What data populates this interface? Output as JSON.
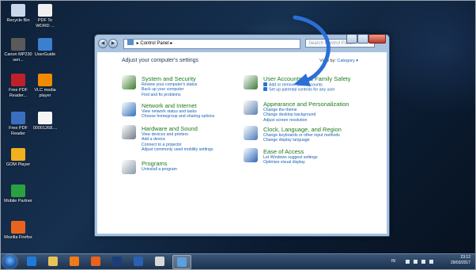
{
  "desktop": {
    "icons": [
      {
        "label": "Recycle Bin",
        "icon": "recycle-bin-icon",
        "color": "#c8d8ea"
      },
      {
        "label": "PDF To WORD ...",
        "icon": "pdf-document-icon",
        "color": "#f0f0f0"
      },
      {
        "label": "Canon MP230 seri...",
        "icon": "printer-icon",
        "color": "#5a5a5a"
      },
      {
        "label": "UserGuide",
        "icon": "guide-icon",
        "color": "#3a7fd0"
      },
      {
        "label": "Free PDF Reader...",
        "icon": "pdf-reader-icon",
        "color": "#c0202a"
      },
      {
        "label": "VLC media player",
        "icon": "vlc-icon",
        "color": "#f08a00"
      },
      {
        "label": "Free PDF Reader",
        "icon": "pdf-reader-icon",
        "color": "#3a6fc0"
      },
      {
        "label": "00001268....",
        "icon": "file-icon",
        "color": "#f5f5f5"
      },
      {
        "label": "GOM Player",
        "icon": "gom-player-icon",
        "color": "#f0b020"
      },
      {
        "label": "Mobile Partner",
        "icon": "mobile-partner-icon",
        "color": "#2aa040"
      },
      {
        "label": "Mozilla Firefox",
        "icon": "firefox-icon",
        "color": "#e8641e"
      }
    ]
  },
  "window": {
    "address": "Control Panel",
    "search_placeholder": "Search Control Panel",
    "heading": "Adjust your computer's settings",
    "view_by_label": "View by:",
    "view_by_value": "Category ▾",
    "categories": [
      {
        "title": "System and Security",
        "icon": "shield-flag-icon",
        "color": "#3a7d2a",
        "links": [
          "Review your computer's status",
          "Back up your computer",
          "Find and fix problems"
        ]
      },
      {
        "title": "User Accounts and Family Safety",
        "icon": "users-icon",
        "color": "#3d7a3d",
        "links": [
          "Add or remove user accounts",
          "Set up parental controls for any user"
        ]
      },
      {
        "title": "Network and Internet",
        "icon": "globe-network-icon",
        "color": "#2f6fb7",
        "links": [
          "View network status and tasks",
          "Choose homegroup and sharing options"
        ]
      },
      {
        "title": "Appearance and Personalization",
        "icon": "display-icon",
        "color": "#5b7fb0",
        "links": [
          "Change the theme",
          "Change desktop background",
          "Adjust screen resolution"
        ]
      },
      {
        "title": "Hardware and Sound",
        "icon": "printer-speaker-icon",
        "color": "#707a88",
        "links": [
          "View devices and printers",
          "Add a device",
          "Connect to a projector",
          "Adjust commonly used mobility settings"
        ]
      },
      {
        "title": "Clock, Language, and Region",
        "icon": "clock-globe-icon",
        "color": "#4a7ab8",
        "links": [
          "Change keyboards or other input methods",
          "Change display language"
        ]
      },
      {
        "title": "Programs",
        "icon": "programs-icon",
        "color": "#8a9aa8",
        "links": [
          "Uninstall a program"
        ]
      },
      {
        "title": "Ease of Access",
        "icon": "ease-of-access-icon",
        "color": "#2a66b8",
        "links": [
          "Let Windows suggest settings",
          "Optimize visual display"
        ]
      }
    ]
  },
  "taskbar": {
    "items": [
      {
        "icon": "internet-explorer-icon",
        "color": "#1f7ad8"
      },
      {
        "icon": "file-explorer-icon",
        "color": "#e8c25a"
      },
      {
        "icon": "media-player-icon",
        "color": "#f07a1a"
      },
      {
        "icon": "firefox-icon",
        "color": "#e8641e"
      },
      {
        "icon": "photoshop-icon",
        "color": "#1b3d7a"
      },
      {
        "icon": "word-icon",
        "color": "#2b5faf"
      },
      {
        "icon": "paint-icon",
        "color": "#d9d9d9"
      },
      {
        "icon": "control-panel-icon",
        "color": "#5aa0e0"
      }
    ],
    "language": "IN",
    "time": "23:12",
    "date": "29/03/2017"
  },
  "annotation": {
    "arrow_color": "#2b6fd6"
  }
}
